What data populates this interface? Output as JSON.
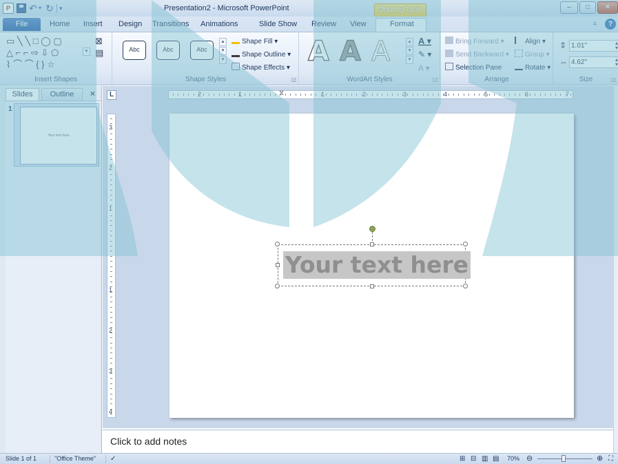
{
  "window": {
    "app_letter": "P",
    "title": "Presentation2 - Microsoft PowerPoint",
    "contextual_tab": "Drawing Tools"
  },
  "tabs": {
    "file": "File",
    "items": [
      "Home",
      "Insert",
      "Design",
      "Transitions",
      "Animations",
      "Slide Show",
      "Review",
      "View",
      "Format"
    ],
    "active": "Format"
  },
  "ribbon": {
    "insert_shapes": {
      "label": "Insert Shapes",
      "glyphs_row1": "▭ ╲ ╲ □ ◯ ▢",
      "glyphs_row2": "△ ⌐ ⌐ ⇨ ⇩ ⬠",
      "glyphs_row3": "⌇ ⌒ ⌒ { } ☆"
    },
    "shape_styles": {
      "label": "Shape Styles",
      "samples": [
        "Abc",
        "Abc",
        "Abc"
      ],
      "shape_fill": "Shape Fill",
      "shape_outline": "Shape Outline",
      "shape_effects": "Shape Effects"
    },
    "wordart_styles": {
      "label": "WordArt Styles",
      "letters": [
        "A",
        "A",
        "A"
      ]
    },
    "arrange": {
      "label": "Arrange",
      "bring_forward": "Bring Forward",
      "send_backward": "Send Backward",
      "selection_pane": "Selection Pane",
      "align": "Align",
      "group": "Group",
      "rotate": "Rotate"
    },
    "size": {
      "label": "Size",
      "height": "1.01\"",
      "width": "4.62\""
    }
  },
  "slides_pane": {
    "tab_slides": "Slides",
    "tab_outline": "Outline",
    "close": "×",
    "slide_number": "1",
    "thumb_text": "Your text here"
  },
  "rulers": {
    "corner": "L",
    "h_labels": [
      "2",
      "1",
      "1",
      "2",
      "3",
      "4",
      "5",
      "6",
      "7"
    ],
    "v_labels": [
      "3",
      "2",
      "1",
      "1",
      "2",
      "3",
      "4"
    ]
  },
  "slide": {
    "text": "Your text here"
  },
  "notes": {
    "placeholder": "Click to add notes"
  },
  "status": {
    "slide_info": "Slide 1 of 1",
    "theme": "\"Office Theme\"",
    "zoom": "70%"
  },
  "colors": {
    "accent": "#2a5aa5",
    "contextual_tab": "#e7c64c",
    "watermark": "#7fc0d1"
  }
}
